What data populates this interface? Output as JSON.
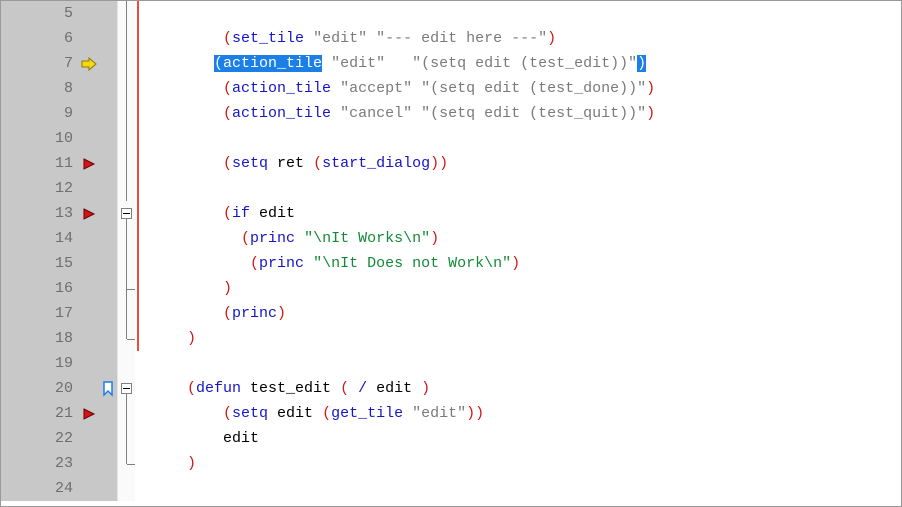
{
  "colors": {
    "paren": "#d01818",
    "builtin": "#1515c4",
    "symbol": "#000000",
    "string_light": "#7a7a7a",
    "string_green": "#138a36",
    "selection_bg": "#1a7fe6",
    "gutter_bg": "#c8c8c8",
    "fold_border": "#808080",
    "scope_red": "#e74c3c"
  },
  "icons": {
    "current_line": "arrow-icon",
    "breakpoint": "bp-icon",
    "bookmark": "bm-icon"
  },
  "lines": [
    {
      "num": "5",
      "marker": null,
      "bookmark": false,
      "fold": "line",
      "scope": true,
      "indent": "        ",
      "tokens": []
    },
    {
      "num": "6",
      "marker": null,
      "bookmark": false,
      "fold": "line",
      "scope": true,
      "indent": "        ",
      "tokens": [
        {
          "c": "t-paren",
          "t": "("
        },
        {
          "c": "t-built",
          "t": "set_tile"
        },
        {
          "c": "t-sym",
          "t": " "
        },
        {
          "c": "t-str",
          "t": "\"edit\""
        },
        {
          "c": "t-sym",
          "t": " "
        },
        {
          "c": "t-str",
          "t": "\"--- edit here ---\""
        },
        {
          "c": "t-paren",
          "t": ")"
        }
      ]
    },
    {
      "num": "7",
      "marker": "arrow",
      "bookmark": false,
      "fold": "line",
      "scope": true,
      "indent": "       ",
      "selected": true,
      "tokens": [
        {
          "sel": true,
          "c": "t-paren",
          "t": "("
        },
        {
          "sel": true,
          "c": "t-built",
          "t": "action_tile"
        },
        {
          "c": "t-sym",
          "t": " "
        },
        {
          "c": "t-str",
          "t": "\"edit\""
        },
        {
          "c": "t-sym",
          "t": "   "
        },
        {
          "c": "t-str",
          "t": "\"(setq edit (test_edit))\""
        },
        {
          "sel": true,
          "c": "t-paren",
          "t": ")"
        }
      ]
    },
    {
      "num": "8",
      "marker": null,
      "bookmark": false,
      "fold": "line",
      "scope": true,
      "indent": "        ",
      "tokens": [
        {
          "c": "t-paren",
          "t": "("
        },
        {
          "c": "t-built",
          "t": "action_tile"
        },
        {
          "c": "t-sym",
          "t": " "
        },
        {
          "c": "t-str",
          "t": "\"accept\""
        },
        {
          "c": "t-sym",
          "t": " "
        },
        {
          "c": "t-str",
          "t": "\"(setq edit (test_done))\""
        },
        {
          "c": "t-paren",
          "t": ")"
        }
      ]
    },
    {
      "num": "9",
      "marker": null,
      "bookmark": false,
      "fold": "line",
      "scope": true,
      "indent": "        ",
      "tokens": [
        {
          "c": "t-paren",
          "t": "("
        },
        {
          "c": "t-built",
          "t": "action_tile"
        },
        {
          "c": "t-sym",
          "t": " "
        },
        {
          "c": "t-str",
          "t": "\"cancel\""
        },
        {
          "c": "t-sym",
          "t": " "
        },
        {
          "c": "t-str",
          "t": "\"(setq edit (test_quit))\""
        },
        {
          "c": "t-paren",
          "t": ")"
        }
      ]
    },
    {
      "num": "10",
      "marker": null,
      "bookmark": false,
      "fold": "line",
      "scope": true,
      "indent": "",
      "tokens": []
    },
    {
      "num": "11",
      "marker": "bp",
      "bookmark": false,
      "fold": "line",
      "scope": true,
      "indent": "        ",
      "tokens": [
        {
          "c": "t-paren",
          "t": "("
        },
        {
          "c": "t-built",
          "t": "setq"
        },
        {
          "c": "t-sym",
          "t": " ret "
        },
        {
          "c": "t-paren",
          "t": "("
        },
        {
          "c": "t-built",
          "t": "start_dialog"
        },
        {
          "c": "t-paren",
          "t": ")"
        },
        {
          "c": "t-paren",
          "t": ")"
        }
      ]
    },
    {
      "num": "12",
      "marker": null,
      "bookmark": false,
      "fold": "line",
      "scope": true,
      "indent": "",
      "tokens": []
    },
    {
      "num": "13",
      "marker": "bp",
      "bookmark": false,
      "fold": "box",
      "scope": true,
      "indent": "        ",
      "tokens": [
        {
          "c": "t-paren",
          "t": "("
        },
        {
          "c": "t-built",
          "t": "if"
        },
        {
          "c": "t-sym",
          "t": " edit"
        }
      ]
    },
    {
      "num": "14",
      "marker": null,
      "bookmark": false,
      "fold": "line",
      "scope": true,
      "indent": "          ",
      "tokens": [
        {
          "c": "t-paren",
          "t": "("
        },
        {
          "c": "t-built",
          "t": "princ"
        },
        {
          "c": "t-sym",
          "t": " "
        },
        {
          "c": "t-strD",
          "t": "\"\\nIt Works\\n\""
        },
        {
          "c": "t-paren",
          "t": ")"
        }
      ]
    },
    {
      "num": "15",
      "marker": null,
      "bookmark": false,
      "fold": "line",
      "scope": true,
      "indent": "           ",
      "tokens": [
        {
          "c": "t-paren",
          "t": "("
        },
        {
          "c": "t-built",
          "t": "princ"
        },
        {
          "c": "t-sym",
          "t": " "
        },
        {
          "c": "t-strD",
          "t": "\"\\nIt Does not Work\\n\""
        },
        {
          "c": "t-paren",
          "t": ")"
        }
      ]
    },
    {
      "num": "16",
      "marker": null,
      "bookmark": false,
      "fold": "end-h",
      "scope": true,
      "indent": "        ",
      "tokens": [
        {
          "c": "t-paren",
          "t": ")"
        }
      ]
    },
    {
      "num": "17",
      "marker": null,
      "bookmark": false,
      "fold": "line",
      "scope": true,
      "indent": "        ",
      "tokens": [
        {
          "c": "t-paren",
          "t": "("
        },
        {
          "c": "t-built",
          "t": "princ"
        },
        {
          "c": "t-paren",
          "t": ")"
        }
      ]
    },
    {
      "num": "18",
      "marker": null,
      "bookmark": false,
      "fold": "end",
      "scope": true,
      "indent": "    ",
      "tokens": [
        {
          "c": "t-paren",
          "t": ")"
        }
      ]
    },
    {
      "num": "19",
      "marker": null,
      "bookmark": false,
      "fold": "none",
      "scope": false,
      "indent": "",
      "tokens": []
    },
    {
      "num": "20",
      "marker": null,
      "bookmark": true,
      "fold": "box",
      "scope": false,
      "indent": "    ",
      "tokens": [
        {
          "c": "t-paren",
          "t": "("
        },
        {
          "c": "t-built",
          "t": "defun"
        },
        {
          "c": "t-sym",
          "t": " test_edit "
        },
        {
          "c": "t-paren",
          "t": "("
        },
        {
          "c": "t-sym",
          "t": " "
        },
        {
          "c": "t-built",
          "t": "/"
        },
        {
          "c": "t-sym",
          "t": " edit "
        },
        {
          "c": "t-paren",
          "t": ")"
        }
      ]
    },
    {
      "num": "21",
      "marker": "bp",
      "bookmark": false,
      "fold": "line",
      "scope": false,
      "indent": "        ",
      "tokens": [
        {
          "c": "t-paren",
          "t": "("
        },
        {
          "c": "t-built",
          "t": "setq"
        },
        {
          "c": "t-sym",
          "t": " edit "
        },
        {
          "c": "t-paren",
          "t": "("
        },
        {
          "c": "t-built",
          "t": "get_tile"
        },
        {
          "c": "t-sym",
          "t": " "
        },
        {
          "c": "t-str",
          "t": "\"edit\""
        },
        {
          "c": "t-paren",
          "t": ")"
        },
        {
          "c": "t-paren",
          "t": ")"
        }
      ]
    },
    {
      "num": "22",
      "marker": null,
      "bookmark": false,
      "fold": "line",
      "scope": false,
      "indent": "        ",
      "tokens": [
        {
          "c": "t-sym",
          "t": "edit"
        }
      ]
    },
    {
      "num": "23",
      "marker": null,
      "bookmark": false,
      "fold": "end",
      "scope": false,
      "indent": "    ",
      "tokens": [
        {
          "c": "t-paren",
          "t": ")"
        }
      ]
    },
    {
      "num": "24",
      "marker": null,
      "bookmark": false,
      "fold": "none",
      "scope": false,
      "indent": "",
      "tokens": []
    }
  ]
}
